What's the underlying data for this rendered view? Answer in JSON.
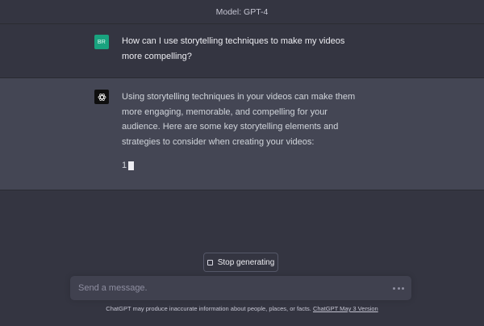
{
  "header": {
    "model_label": "Model: GPT-4"
  },
  "conversation": {
    "user": {
      "avatar_initials": "BR",
      "avatar_color": "#19a37f",
      "text": "How can I use storytelling techniques to make my videos more compelling?"
    },
    "assistant": {
      "avatar_icon": "openai-logo-icon",
      "text": "Using storytelling techniques in your videos can make them more engaging, memorable, and compelling for your audience. Here are some key storytelling elements and strategies to consider when creating your videos:",
      "partial_text": "1"
    }
  },
  "controls": {
    "stop_button_label": "Stop generating",
    "stop_icon": "stop-square-icon"
  },
  "composer": {
    "placeholder": "Send a message.",
    "more_icon": "ellipsis-icon"
  },
  "footer": {
    "disclaimer": "ChatGPT may produce inaccurate information about people, places, or facts.",
    "version_link": "ChatGPT May 3 Version"
  },
  "colors": {
    "background": "#343541",
    "assistant_background": "#444654",
    "input_background": "#40414f"
  }
}
